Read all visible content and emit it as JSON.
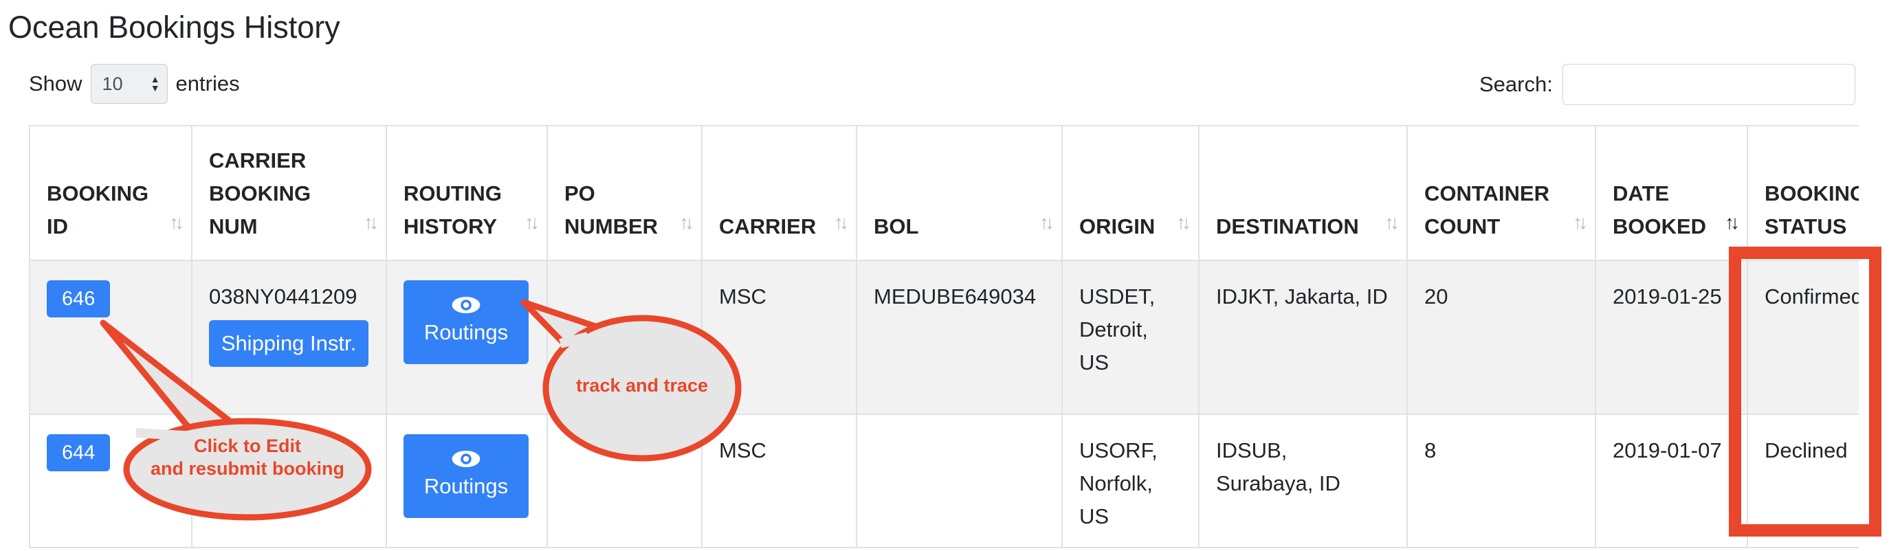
{
  "page": {
    "title": "Ocean Bookings History"
  },
  "length": {
    "show_label": "Show",
    "value": "10",
    "entries_label": "entries"
  },
  "search": {
    "label": "Search:",
    "value": "",
    "placeholder": ""
  },
  "columns": [
    {
      "label": "BOOKING ID",
      "sort": "none"
    },
    {
      "label": "CARRIER BOOKING NUM",
      "sort": "none"
    },
    {
      "label": "ROUTING HISTORY",
      "sort": "none"
    },
    {
      "label": "PO NUMBER",
      "sort": "none"
    },
    {
      "label": "CARRIER",
      "sort": "none"
    },
    {
      "label": "BOL",
      "sort": "none"
    },
    {
      "label": "ORIGIN",
      "sort": "none"
    },
    {
      "label": "DESTINATION",
      "sort": "none"
    },
    {
      "label": "CONTAINER COUNT",
      "sort": "none"
    },
    {
      "label": "DATE BOOKED",
      "sort": "desc"
    },
    {
      "label": "BOOKING STATUS",
      "sort": "none"
    }
  ],
  "rows": [
    {
      "booking_id": "646",
      "carrier_booking_num": "038NY0441209",
      "shipping_instr_label": "Shipping Instr.",
      "routings_label": "Routings",
      "po_number": "",
      "carrier": "MSC",
      "bol": "MEDUBE649034",
      "origin": "USDET, Detroit, US",
      "destination": "IDJKT, Jakarta, ID",
      "container_count": "20",
      "date_booked": "2019-01-25",
      "status": "Confirmed"
    },
    {
      "booking_id": "644",
      "carrier_booking_num": "",
      "routings_label": "Routings",
      "po_number": "",
      "carrier": "MSC",
      "bol": "",
      "origin": "USORF, Norfolk, US",
      "destination": "IDSUB, Surabaya, ID",
      "container_count": "8",
      "date_booked": "2019-01-07",
      "status": "Declined"
    }
  ],
  "annotations": {
    "edit_callout_line1": "Click to Edit",
    "edit_callout_line2": "and resubmit booking",
    "track_callout": "track and trace",
    "color": "#e8472b",
    "fill": "#e6e6e6"
  },
  "colors": {
    "button": "#3281f6",
    "row_stripe": "#f2f2f2"
  }
}
